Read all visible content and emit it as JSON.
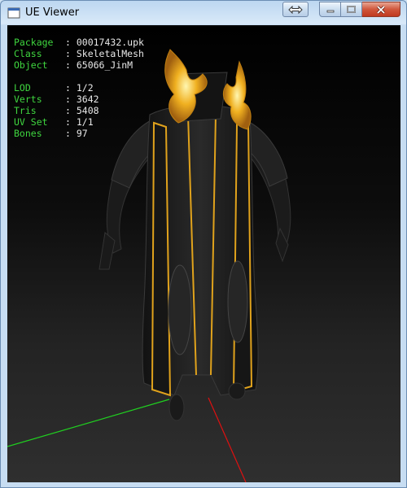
{
  "window": {
    "title": "UE Viewer"
  },
  "info": {
    "package_label": "Package",
    "package": "00017432.upk",
    "class_label": "Class",
    "class": "SkeletalMesh",
    "object_label": "Object",
    "object": "65066_JinM",
    "lod_label": "LOD",
    "lod": "1/2",
    "verts_label": "Verts",
    "verts": "3642",
    "tris_label": "Tris",
    "tris": "5408",
    "uvset_label": "UV Set",
    "uvset": "1/1",
    "bones_label": "Bones",
    "bones": "97"
  },
  "colors": {
    "label": "#3fd63f",
    "value": "#e8e8e8",
    "gold": "#e0a21c",
    "axis_x": "#e01010",
    "axis_y": "#20d020"
  }
}
